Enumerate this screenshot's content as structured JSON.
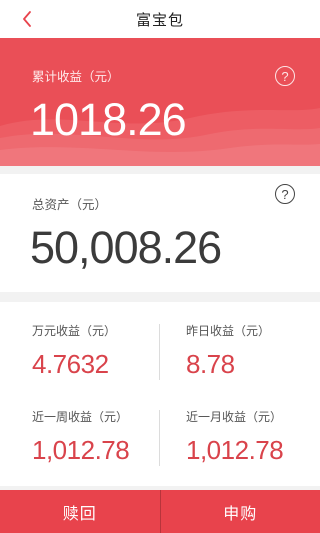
{
  "nav": {
    "title": "富宝包",
    "back_icon": "chevron-left-icon"
  },
  "colors": {
    "accent": "#ea4f57",
    "value_red": "#d9434b",
    "button_red": "#e8434c"
  },
  "earnings": {
    "label": "累计收益（元）",
    "value": "1018.26",
    "help_icon": "question-circle-icon"
  },
  "assets": {
    "label": "总资产（元）",
    "value": "50,008.26",
    "help_icon": "question-circle-icon"
  },
  "stats": {
    "wan_yuan": {
      "label": "万元收益（元）",
      "value": "4.7632"
    },
    "yesterday": {
      "label": "昨日收益（元）",
      "value": "8.78"
    },
    "week": {
      "label": "近一周收益（元）",
      "value": "1,012.78"
    },
    "month": {
      "label": "近一月收益（元）",
      "value": "1,012.78"
    }
  },
  "actions": {
    "redeem": "赎回",
    "purchase": "申购"
  }
}
